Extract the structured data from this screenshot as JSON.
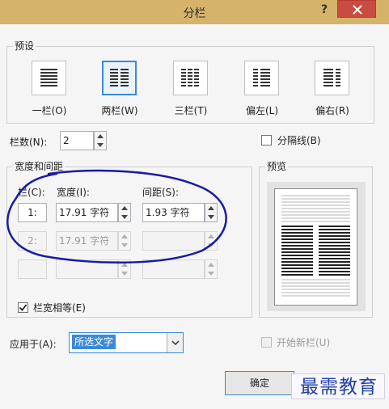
{
  "window": {
    "title": "分栏",
    "help_label": "?",
    "close_icon": "close-icon"
  },
  "presets": {
    "group_title": "预设",
    "items": [
      {
        "label": "一栏(O)",
        "icon": "one-column-icon",
        "selected": false
      },
      {
        "label": "两栏(W)",
        "icon": "two-columns-icon",
        "selected": true
      },
      {
        "label": "三栏(T)",
        "icon": "three-columns-icon",
        "selected": false
      },
      {
        "label": "偏左(L)",
        "icon": "left-column-icon",
        "selected": false
      },
      {
        "label": "偏右(R)",
        "icon": "right-column-icon",
        "selected": false
      }
    ]
  },
  "num_columns": {
    "label": "栏数(N):",
    "value": "2"
  },
  "separator": {
    "label": "分隔线(B)",
    "checked": false
  },
  "width_spacing": {
    "group_title": "宽度和间距",
    "col_header": "栏(C):",
    "width_header": "宽度(I):",
    "spacing_header": "间距(S):",
    "rows": [
      {
        "col": "1:",
        "width": "17.91 字符",
        "spacing": "1.93 字符",
        "enabled": true
      },
      {
        "col": "2:",
        "width": "17.91 字符",
        "spacing": "",
        "enabled": false
      },
      {
        "col": "",
        "width": "",
        "spacing": "",
        "enabled": false
      }
    ]
  },
  "equal_width": {
    "label": "栏宽相等(E)",
    "checked": true
  },
  "apply_to": {
    "label": "应用于(A):",
    "value": "所选文字"
  },
  "new_column": {
    "label": "开始新栏(U)",
    "checked": false
  },
  "preview": {
    "group_title": "预览"
  },
  "buttons": {
    "ok": "确定"
  },
  "watermark": {
    "text": "最需教育"
  },
  "colors": {
    "accent": "#3b8ad6",
    "titlebar": "#d6b36a",
    "close": "#c94c43",
    "annotation": "#1a1aa8"
  }
}
